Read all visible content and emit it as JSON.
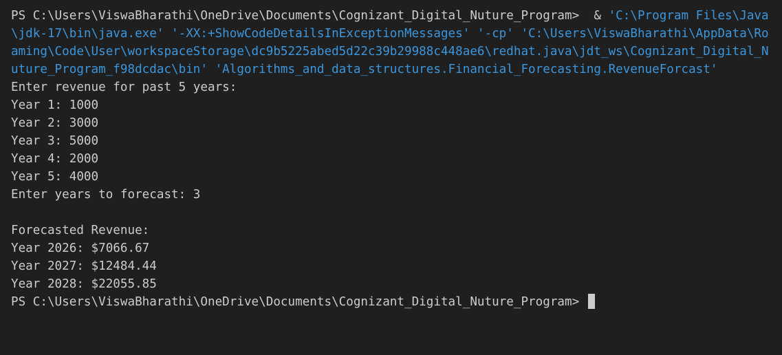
{
  "terminal": {
    "prompt1": "PS C:\\Users\\ViswaBharathi\\OneDrive\\Documents\\Cognizant_Digital_Nuture_Program> ",
    "operator": " & ",
    "command": "'C:\\Program Files\\Java\\jdk-17\\bin\\java.exe' '-XX:+ShowCodeDetailsInExceptionMessages' '-cp' 'C:\\Users\\ViswaBharathi\\AppData\\Roaming\\Code\\User\\workspaceStorage\\dc9b5225abed5d22c39b29988c448ae6\\redhat.java\\jdt_ws\\Cognizant_Digital_Nuture_Program_f98dcdac\\bin' 'Algorithms_and_data_structures.Financial_Forecasting.RevenueForcast'",
    "output": [
      "Enter revenue for past 5 years:",
      "Year 1: 1000",
      "Year 2: 3000",
      "Year 3: 5000",
      "Year 4: 2000",
      "Year 5: 4000",
      "Enter years to forecast: 3",
      "",
      "Forecasted Revenue:",
      "Year 2026: $7066.67",
      "Year 2027: $12484.44",
      "Year 2028: $22055.85"
    ],
    "prompt2": "PS C:\\Users\\ViswaBharathi\\OneDrive\\Documents\\Cognizant_Digital_Nuture_Program> ",
    "colors": {
      "background": "#1f1f1f",
      "text": "#cccccc",
      "command": "#3a96dd"
    }
  }
}
